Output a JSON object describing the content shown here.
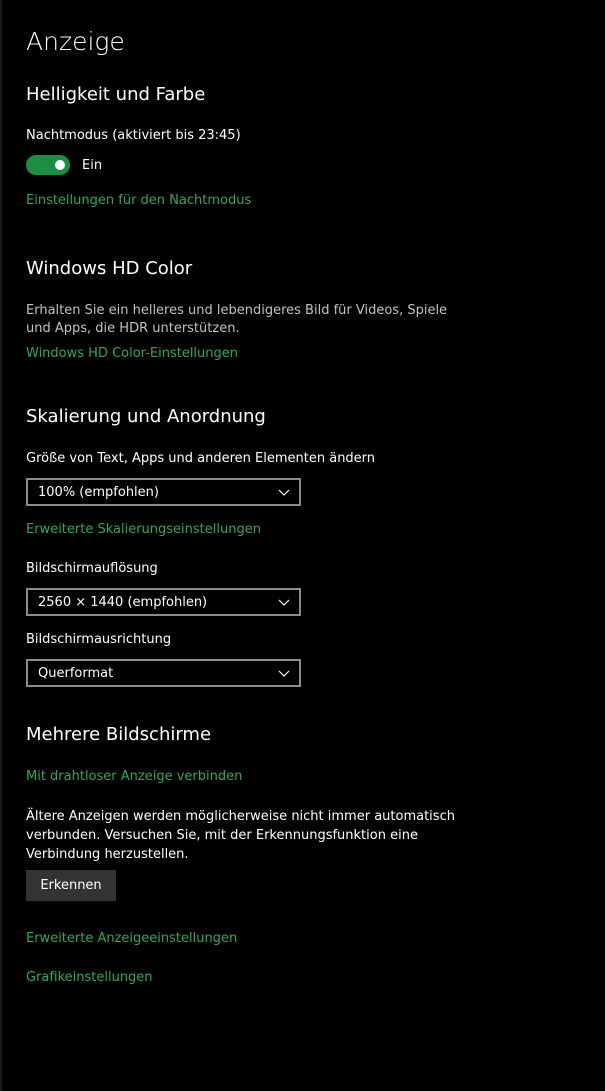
{
  "page": {
    "title": "Anzeige"
  },
  "brightness": {
    "title": "Helligkeit und Farbe",
    "night_mode_label": "Nachtmodus (aktiviert bis 23:45)",
    "night_mode_on": true,
    "night_mode_state": "Ein",
    "night_mode_settings_link": "Einstellungen für den Nachtmodus"
  },
  "hd_color": {
    "title": "Windows HD Color",
    "description": "Erhalten Sie ein helleres und lebendigeres Bild für Videos, Spiele und Apps, die HDR unterstützen.",
    "settings_link": "Windows HD Color-Einstellungen"
  },
  "scaling": {
    "title": "Skalierung und Anordnung",
    "size_label": "Größe von Text, Apps und anderen Elementen ändern",
    "size_value": "100% (empfohlen)",
    "advanced_link": "Erweiterte Skalierungseinstellungen",
    "resolution_label": "Bildschirmauflösung",
    "resolution_value": "2560 × 1440 (empfohlen)",
    "orientation_label": "Bildschirmausrichtung",
    "orientation_value": "Querformat"
  },
  "multi_display": {
    "title": "Mehrere Bildschirme",
    "wireless_link": "Mit drahtloser Anzeige verbinden",
    "info_text": "Ältere Anzeigen werden möglicherweise nicht immer automatisch verbunden. Versuchen Sie, mit der Erkennungsfunktion eine Verbindung herzustellen.",
    "detect_button": "Erkennen"
  },
  "footer_links": {
    "advanced_display": "Erweiterte Anzeigeeinstellungen",
    "graphics": "Grafikeinstellungen"
  },
  "colors": {
    "background": "#000000",
    "accent_link": "#33a853",
    "toggle_on": "#1a8f3f",
    "button_bg": "#333333"
  },
  "icons": {
    "dropdown": "chevron-down-icon"
  }
}
